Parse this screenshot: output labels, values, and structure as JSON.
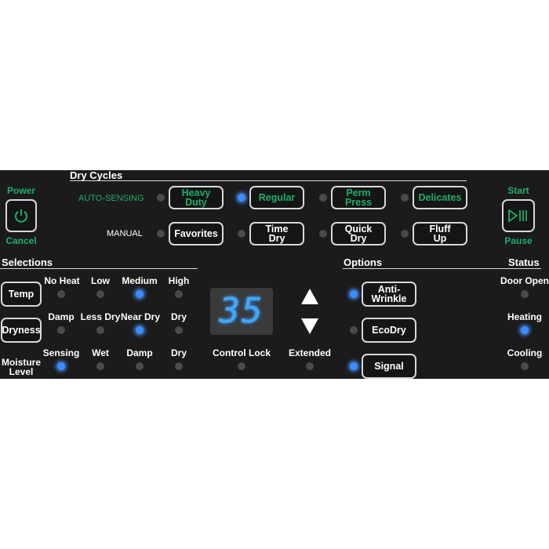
{
  "power": {
    "label": "Power",
    "cancel": "Cancel"
  },
  "start": {
    "label": "Start",
    "pause": "Pause"
  },
  "dry_cycles": {
    "title": "Dry Cycles",
    "auto_sensing": "AUTO-SENSING",
    "manual": "MANUAL",
    "heavy_duty": "Heavy Duty",
    "regular": "Regular",
    "perm_press": "Perm Press",
    "delicates": "Delicates",
    "favorites": "Favorites",
    "time_dry": "Time Dry",
    "quick_dry": "Quick Dry",
    "fluff_up": "Fluff Up"
  },
  "selections": {
    "title": "Selections",
    "temp": "Temp",
    "dryness": "Dryness",
    "moisture_level": "Moisture Level",
    "temp_levels": [
      "No Heat",
      "Low",
      "Medium",
      "High"
    ],
    "dryness_levels": [
      "Damp",
      "Less Dry",
      "Near Dry",
      "Dry"
    ],
    "moisture_levels": [
      "Sensing",
      "Wet",
      "Damp",
      "Dry"
    ]
  },
  "display": {
    "value": "35"
  },
  "control_lock": "Control Lock",
  "extended": "Extended",
  "options": {
    "title": "Options",
    "anti_wrinkle": "Anti-Wrinkle",
    "ecodry": "EcoDry",
    "signal": "Signal"
  },
  "status": {
    "title": "Status",
    "door_open": "Door Open",
    "heating": "Heating",
    "cooling": "Cooling"
  },
  "colors": {
    "panel": "#1b1b1b",
    "accent_green": "#1fae6a",
    "led_on": "#3a8cff",
    "led_off": "#4a4a4a"
  }
}
